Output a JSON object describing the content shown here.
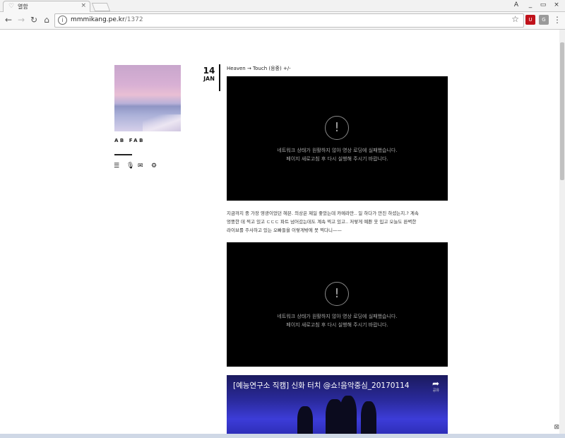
{
  "browser": {
    "tab_title": "열함",
    "tab_close": "×",
    "url_host": "mmmikang.pe.kr",
    "url_path": "/1372",
    "window_controls": [
      "_",
      "▭",
      "×"
    ],
    "profile_glyph": "A",
    "extension_labels": [
      "U",
      "G"
    ]
  },
  "sidebar": {
    "blog_name": "AB FAB",
    "icons": [
      "list-icon",
      "microphone-icon",
      "mail-icon",
      "gear-icon"
    ]
  },
  "post": {
    "day": "14",
    "month": "JAN",
    "title": "Heaven → Touch (응중)  +/-",
    "video_error_line1": "네트워크 상태가 원활하지 않아 영상 로딩에 실패했습니다.",
    "video_error_line2": "페이지 새로고침 후 다시 실행해 주시기 바랍니다.",
    "text_lines": [
      "지금까지 중 가장 영광이었던 헤븐. 의상은 제일 좋았는데 카메라만.. 일 하다가 만진 하셨는지.? 계속",
      "엉뚱한 데 찍고 있고 ㄷㄷㄷ 파트 넘어갔는데도 계속 찍고 있고.. 저렇게 예쁜 옷 입고 오늘도 완벽한",
      "라이브를 주사하고 있는 오빠들을 이렇게밖에 못 찍다니——"
    ],
    "youtube_title": "[예능연구소 직캠] 신화 터치 @쇼!음악중심_20170114",
    "youtube_share": "공유"
  },
  "colors": {
    "accent": "#111111",
    "video_bg": "#000000"
  }
}
